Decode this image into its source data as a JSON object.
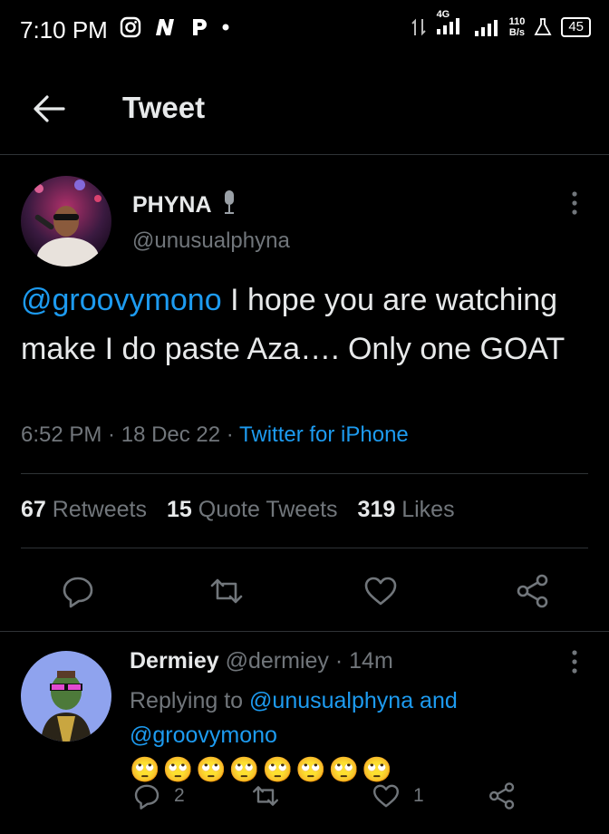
{
  "status_bar": {
    "time": "7:10 PM",
    "network": "4G",
    "speed_value": "110",
    "speed_unit": "B/s",
    "battery": "45"
  },
  "header": {
    "title": "Tweet"
  },
  "tweet": {
    "display_name": "PHYNA",
    "handle": "@unusualphyna",
    "mention": "@groovymono",
    "text": " I hope you are watching make I do paste Aza…. Only one GOAT",
    "time": "6:52 PM",
    "date": "18 Dec 22",
    "source": "Twitter for iPhone",
    "stats": {
      "retweets_count": "67",
      "retweets_label": "Retweets",
      "quotes_count": "15",
      "quotes_label": "Quote Tweets",
      "likes_count": "319",
      "likes_label": "Likes"
    }
  },
  "reply": {
    "display_name": "Dermiey",
    "handle": "@dermiey",
    "age": "14m",
    "replying_prefix": "Replying to ",
    "replying_user1": "@unusualphyna",
    "replying_and": " and",
    "replying_user2": "@groovymono",
    "emojis": "🙄🙄🙄🙄🙄🙄🙄🙄",
    "reply_count": "2",
    "like_count": "1"
  },
  "colors": {
    "accent": "#1d9bf0",
    "muted": "#71767b",
    "text": "#e7e9ea",
    "divider": "#2f3336"
  }
}
